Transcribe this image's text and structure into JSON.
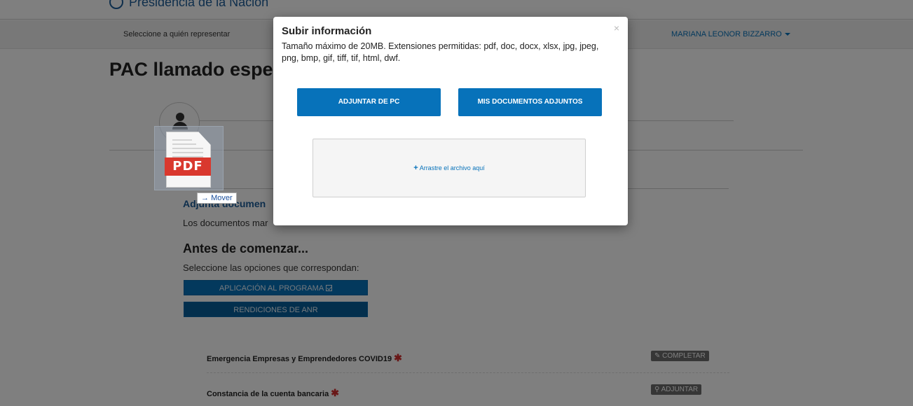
{
  "header": {
    "brand_text": "Presidencia de la Nación",
    "represent_label": "Seleccione a quién representar",
    "user_name": "MARIANA LEONOR BIZZARRO"
  },
  "page": {
    "title": "PAC llamado espec",
    "section_link": "Adjunta documen",
    "docs_text": "Los documentos mar",
    "before_heading": "Antes de comenzar...",
    "options_text": "Seleccione las opciones que correspondan:",
    "option_buttons": [
      "APLICACIÓN AL PROGRAMA",
      "RENDICIONES DE ANR"
    ]
  },
  "drag": {
    "file_badge": "PDF",
    "mover_label": "Mover"
  },
  "documents": [
    {
      "label": "Emergencia Empresas y Emprendedores COVID19",
      "action": "COMPLETAR"
    },
    {
      "label": "Constancia de la cuenta bancaria",
      "action": "ADJUNTAR"
    }
  ],
  "modal": {
    "title": "Subir información",
    "close": "×",
    "description": "Tamaño máximo de 20MB. Extensiones permitidas: pdf, doc, docx, xlsx, jpg, jpeg, png, bmp, gif, tiff, tif, html, dwf.",
    "btn_pc": "ADJUNTAR DE PC",
    "btn_docs": "MIS DOCUMENTOS ADJUNTOS",
    "dropzone": "Arrastre el archivo aquí"
  },
  "colors": {
    "primary": "#0772ba",
    "required": "#d32f2f",
    "pdf_badge": "#d9382e"
  },
  "icons": [
    "brand-seal-icon",
    "user-avatar-icon",
    "caret-down-icon",
    "pdf-file-icon",
    "arrow-right-icon",
    "check-square-icon",
    "required-asterisk-icon",
    "pencil-icon",
    "paperclip-icon",
    "close-icon",
    "plus-icon"
  ]
}
